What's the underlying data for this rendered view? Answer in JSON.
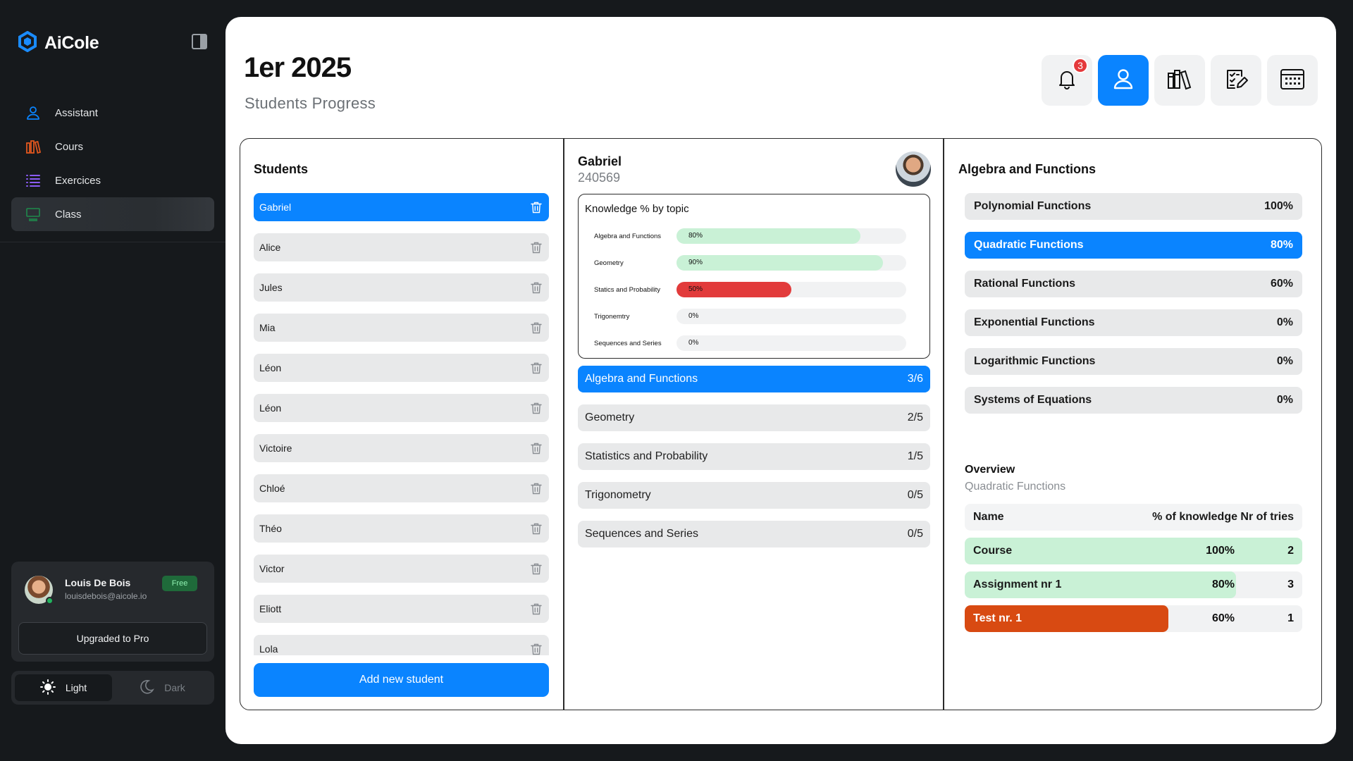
{
  "app": {
    "name": "AiCole"
  },
  "sidebar": {
    "items": [
      {
        "label": "Assistant",
        "icon": "user-icon",
        "color": "#0a84ff",
        "active": false
      },
      {
        "label": "Cours",
        "icon": "books-icon",
        "color": "#e0561e",
        "active": false
      },
      {
        "label": "Exercices",
        "icon": "list-icon",
        "color": "#8b5cf6",
        "active": false
      },
      {
        "label": "Class",
        "icon": "class-icon",
        "color": "#1f8a4c",
        "active": true
      }
    ],
    "user": {
      "name": "Louis De Bois",
      "email": "louisdebois@aicole.io",
      "plan": "Free",
      "upgrade_label": "Upgraded to Pro"
    },
    "theme": {
      "light_label": "Light",
      "dark_label": "Dark",
      "selected": "Light"
    }
  },
  "header": {
    "title": "1er 2025",
    "subtitle": "Students Progress",
    "notification_count": "3"
  },
  "students": {
    "title": "Students",
    "list": [
      "Gabriel",
      "Alice",
      "Jules",
      "Mia",
      "Léon",
      "Léon",
      "Victoire",
      "Chloé",
      "Théo",
      "Victor",
      "Eliott",
      "Lola"
    ],
    "selected": "Gabriel",
    "add_label": "Add new student"
  },
  "student_detail": {
    "name": "Gabriel",
    "id": "240569",
    "knowledge": {
      "title": "Knowledge % by topic",
      "rows": [
        {
          "label": "Algebra and Functions",
          "percent": 80,
          "pct_label": "80%",
          "color": "#c9f1d6"
        },
        {
          "label": "Geometry",
          "percent": 90,
          "pct_label": "90%",
          "color": "#c9f1d6"
        },
        {
          "label": "Statics and Probability",
          "percent": 50,
          "pct_label": "50%",
          "color": "#e23b3b"
        },
        {
          "label": "Trigonemtry",
          "percent": 0,
          "pct_label": "0%",
          "color": "#c9f1d6"
        },
        {
          "label": "Sequences and Series",
          "percent": 0,
          "pct_label": "0%",
          "color": "#c9f1d6"
        }
      ]
    },
    "topics": [
      {
        "name": "Algebra and Functions",
        "score": "3/6",
        "active": true
      },
      {
        "name": "Geometry",
        "score": "2/5",
        "active": false
      },
      {
        "name": "Statistics and Probability",
        "score": "1/5",
        "active": false
      },
      {
        "name": "Trigonometry",
        "score": "0/5",
        "active": false
      },
      {
        "name": "Sequences and Series",
        "score": "0/5",
        "active": false
      }
    ]
  },
  "topic_detail": {
    "title": "Algebra and Functions",
    "subtopics": [
      {
        "name": "Polynomial Functions",
        "pct": "100%",
        "active": false
      },
      {
        "name": "Quadratic Functions",
        "pct": "80%",
        "active": true
      },
      {
        "name": "Rational Functions",
        "pct": "60%",
        "active": false
      },
      {
        "name": "Exponential Functions",
        "pct": "0%",
        "active": false
      },
      {
        "name": "Logarithmic Functions",
        "pct": "0%",
        "active": false
      },
      {
        "name": "Systems of Equations",
        "pct": "0%",
        "active": false
      }
    ],
    "overview": {
      "title": "Overview",
      "subtitle": "Quadratic Functions",
      "headers": {
        "name": "Name",
        "pct": "% of knowledge",
        "tries": "Nr of tries"
      },
      "rows": [
        {
          "name": "Course",
          "pct": "100%",
          "tries": "2",
          "percent": 100,
          "color": "#c9f1d6",
          "text_light": false
        },
        {
          "name": "Assignment nr 1",
          "pct": "80%",
          "tries": "3",
          "percent": 80,
          "color": "#c9f1d6",
          "text_light": false
        },
        {
          "name": "Test nr. 1",
          "pct": "60%",
          "tries": "1",
          "percent": 60,
          "color": "#d84a12",
          "text_light": true
        }
      ]
    }
  }
}
